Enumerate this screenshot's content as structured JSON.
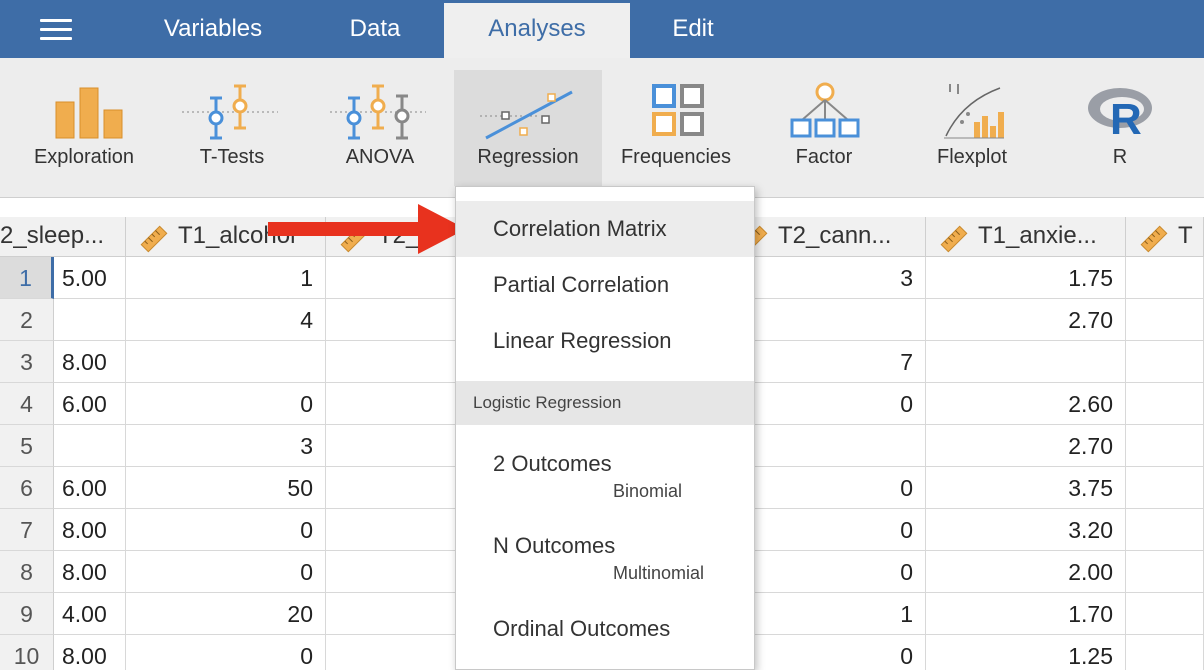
{
  "menu": {
    "tabs": [
      {
        "label": "Variables"
      },
      {
        "label": "Data"
      },
      {
        "label": "Analyses"
      },
      {
        "label": "Edit"
      }
    ],
    "active_tab": "Analyses"
  },
  "ribbon": {
    "buttons": [
      {
        "label": "Exploration",
        "icon": "exploration-icon"
      },
      {
        "label": "T-Tests",
        "icon": "ttests-icon"
      },
      {
        "label": "ANOVA",
        "icon": "anova-icon"
      },
      {
        "label": "Regression",
        "icon": "regression-icon"
      },
      {
        "label": "Frequencies",
        "icon": "frequencies-icon"
      },
      {
        "label": "Factor",
        "icon": "factor-icon"
      },
      {
        "label": "Flexplot",
        "icon": "flexplot-icon"
      },
      {
        "label": "R",
        "icon": "r-icon"
      }
    ],
    "active": "Regression"
  },
  "spreadsheet": {
    "columns": [
      {
        "name": "2_sleep..."
      },
      {
        "name": "T1_alcohol"
      },
      {
        "name": "T2_..."
      },
      {
        "name": "T2_cann..."
      },
      {
        "name": "T1_anxie..."
      },
      {
        "name": "T"
      }
    ],
    "rows": [
      {
        "num": "1",
        "c0": "5.00",
        "c1": "1",
        "c3": "3",
        "c4": "1.75"
      },
      {
        "num": "2",
        "c0": "",
        "c1": "4",
        "c3": "",
        "c4": "2.70"
      },
      {
        "num": "3",
        "c0": "8.00",
        "c1": "",
        "c3": "7",
        "c4": ""
      },
      {
        "num": "4",
        "c0": "6.00",
        "c1": "0",
        "c3": "0",
        "c4": "2.60"
      },
      {
        "num": "5",
        "c0": "",
        "c1": "3",
        "c3": "",
        "c4": "2.70"
      },
      {
        "num": "6",
        "c0": "6.00",
        "c1": "50",
        "c3": "0",
        "c4": "3.75"
      },
      {
        "num": "7",
        "c0": "8.00",
        "c1": "0",
        "c3": "0",
        "c4": "3.20"
      },
      {
        "num": "8",
        "c0": "8.00",
        "c1": "0",
        "c3": "0",
        "c4": "2.00"
      },
      {
        "num": "9",
        "c0": "4.00",
        "c1": "20",
        "c3": "1",
        "c4": "1.70"
      },
      {
        "num": "10",
        "c0": "8.00",
        "c1": "0",
        "c3": "0",
        "c4": "1.25"
      }
    ]
  },
  "dropdown": {
    "items": [
      {
        "label": "Correlation Matrix"
      },
      {
        "label": "Partial Correlation"
      },
      {
        "label": "Linear Regression"
      }
    ],
    "section": "Logistic Regression",
    "logistic": [
      {
        "label": "2 Outcomes",
        "sub": "Binomial"
      },
      {
        "label": "N Outcomes",
        "sub": "Multinomial"
      },
      {
        "label": "Ordinal Outcomes"
      }
    ]
  },
  "colors": {
    "menubar": "#3e6da7",
    "ribbon": "#ededed",
    "icon_blue": "#4a90d9",
    "icon_orange": "#f0ad4e",
    "arrow": "#e8321e"
  }
}
